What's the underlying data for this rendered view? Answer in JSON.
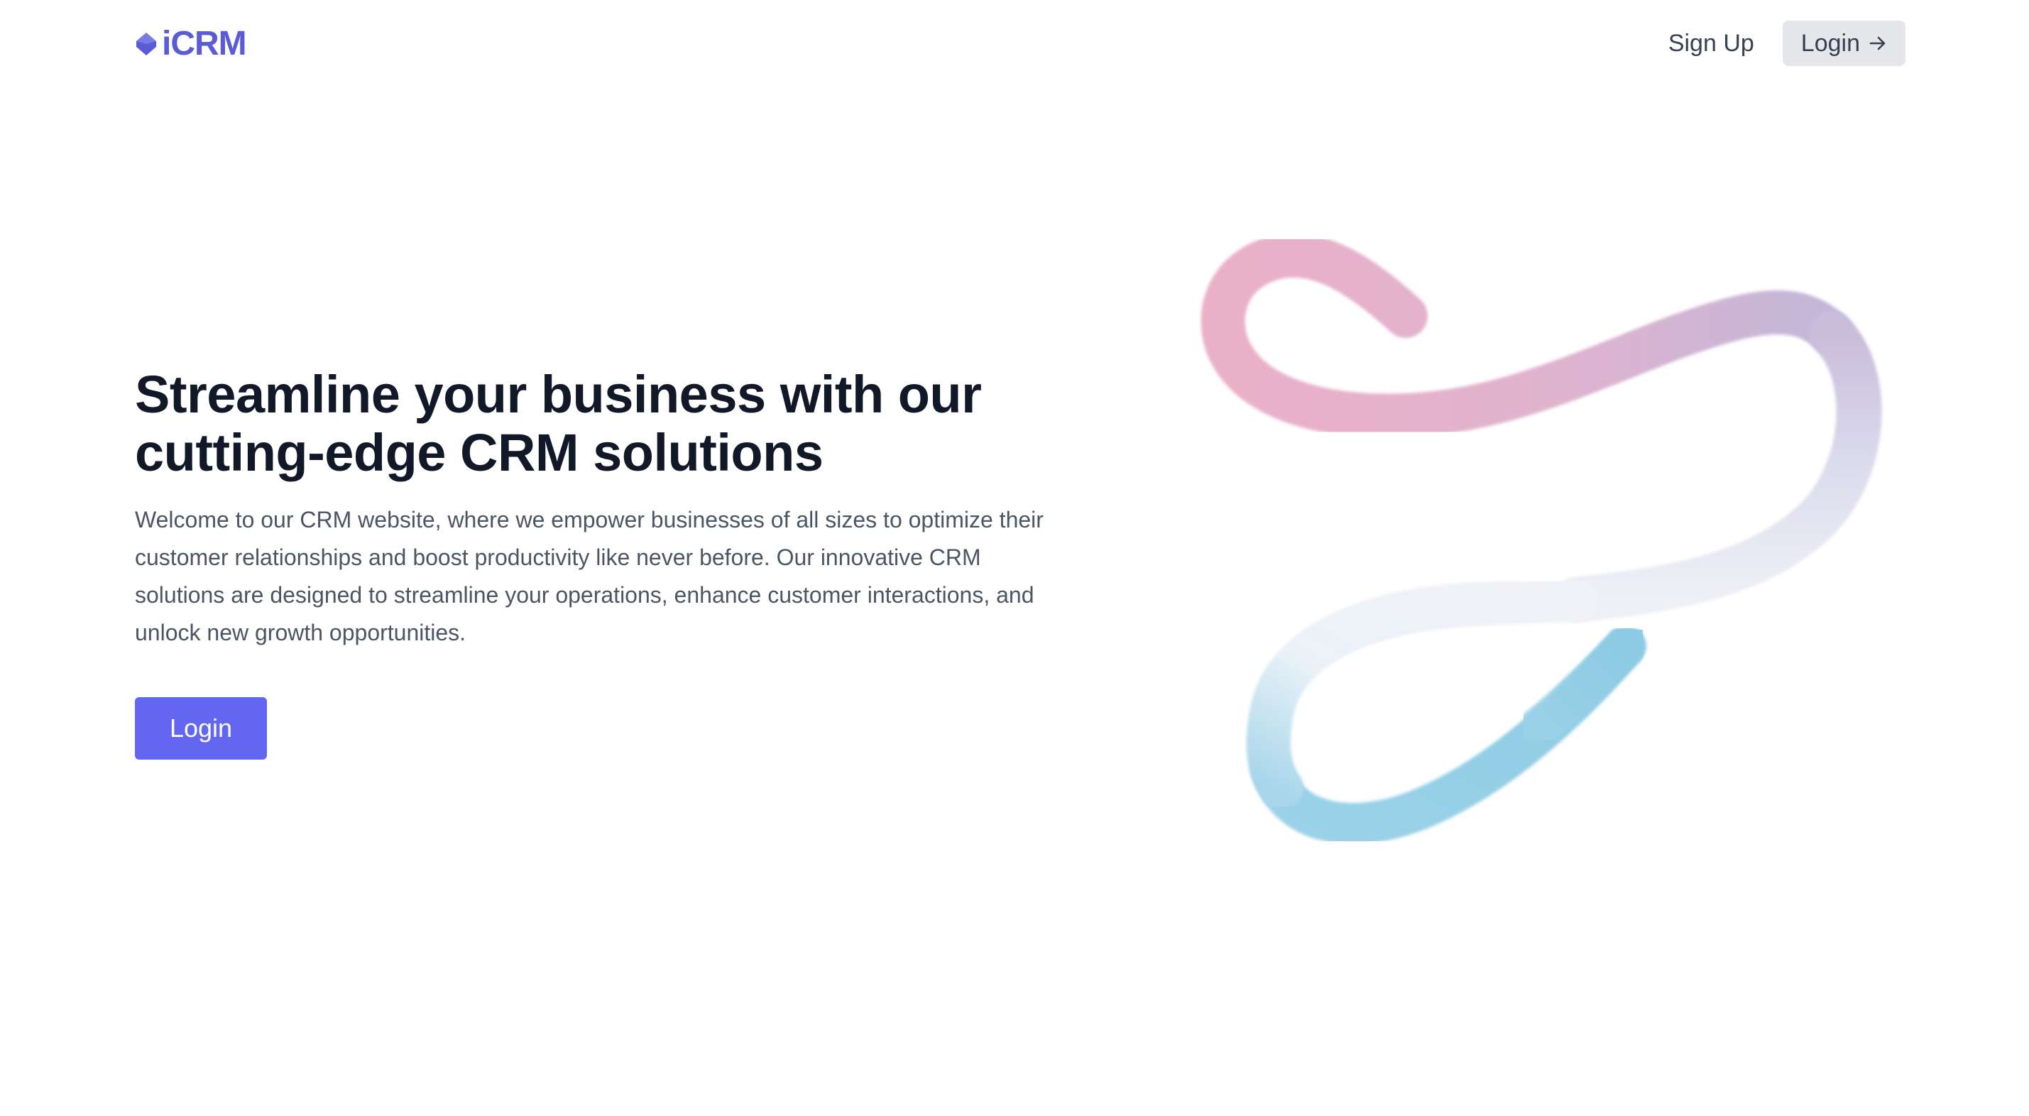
{
  "header": {
    "logo_text": "iCRM",
    "logo_icon": "diamond-icon",
    "signup_label": "Sign Up",
    "login_label": "Login",
    "login_icon": "arrow-right-icon"
  },
  "hero": {
    "title": "Streamline your business with our cutting-edge CRM solutions",
    "description": "Welcome to our CRM website, where we empower businesses of all sizes to optimize their customer relationships and boost productivity like never before. Our innovative CRM solutions are designed to streamline your operations, enhance customer interactions, and unlock new growth opportunities.",
    "cta_label": "Login"
  },
  "colors": {
    "brand": "#5b5bd6",
    "cta": "#6366f1",
    "title": "#111827",
    "body": "#4b5563",
    "ribbon_pink": "#e8a9c4",
    "ribbon_lavender": "#b8aed6",
    "ribbon_white": "#f1f3f8",
    "ribbon_blue": "#7ec6e0"
  }
}
